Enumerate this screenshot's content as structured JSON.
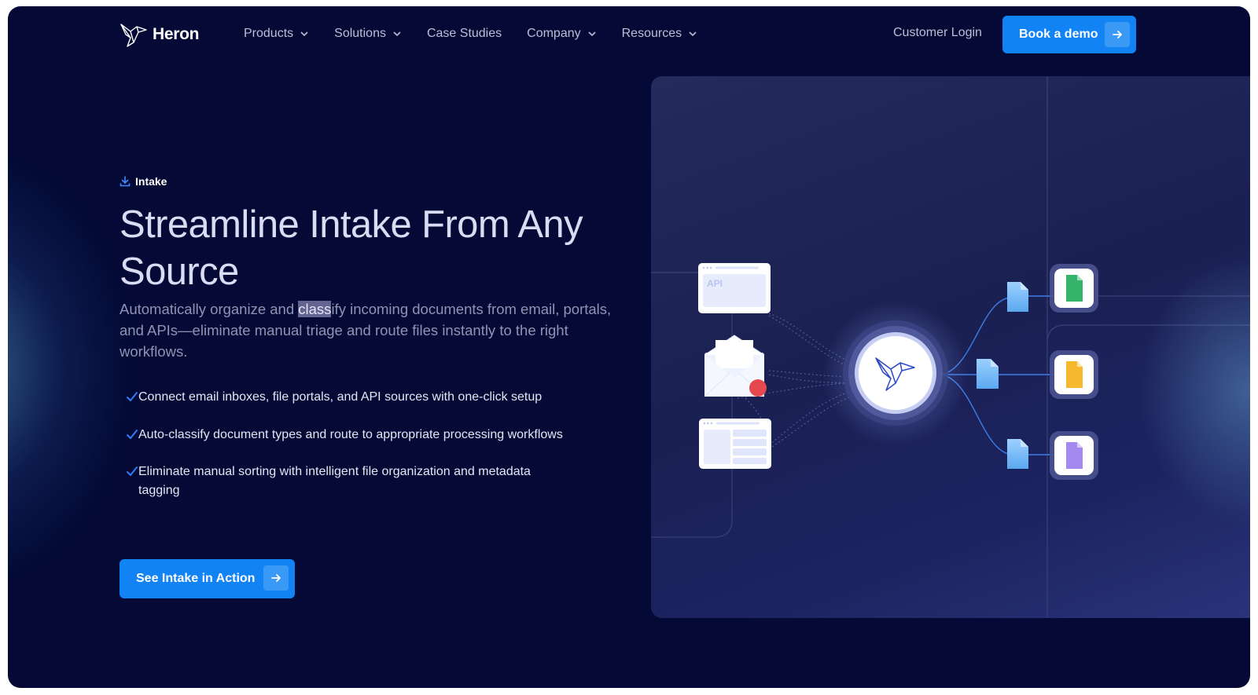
{
  "brand": {
    "name": "Heron",
    "logo_icon": "heron-bird-icon"
  },
  "nav": {
    "items": [
      {
        "label": "Products",
        "has_dropdown": true
      },
      {
        "label": "Solutions",
        "has_dropdown": true
      },
      {
        "label": "Case Studies",
        "has_dropdown": false
      },
      {
        "label": "Company",
        "has_dropdown": true
      },
      {
        "label": "Resources",
        "has_dropdown": true
      }
    ],
    "login_label": "Customer Login",
    "demo_label": "Book a demo"
  },
  "hero": {
    "eyebrow": "Intake",
    "title": "Streamline Intake From Any Source",
    "description_before": "Automatically organize and ",
    "description_highlight": "class",
    "description_after": "ify incoming documents from email, portals, and APIs—eliminate manual triage and route files instantly to the right workflows.",
    "features": [
      "Connect email inboxes, file portals, and API sources with one-click setup",
      "Auto-classify document types and route to appropriate processing workflows",
      "Eliminate manual sorting with intelligent file organization and metadata tagging"
    ],
    "cta_label": "See Intake in Action"
  },
  "illustration": {
    "api_card_label": "API",
    "sources": [
      "api-card",
      "email-envelope",
      "portal-card"
    ],
    "outputs": [
      "green-document",
      "yellow-document",
      "purple-document"
    ]
  },
  "colors": {
    "background": "#040a35",
    "accent": "#1183f5",
    "checkmark": "#2f7cf6",
    "notification_dot": "#e5484d"
  }
}
